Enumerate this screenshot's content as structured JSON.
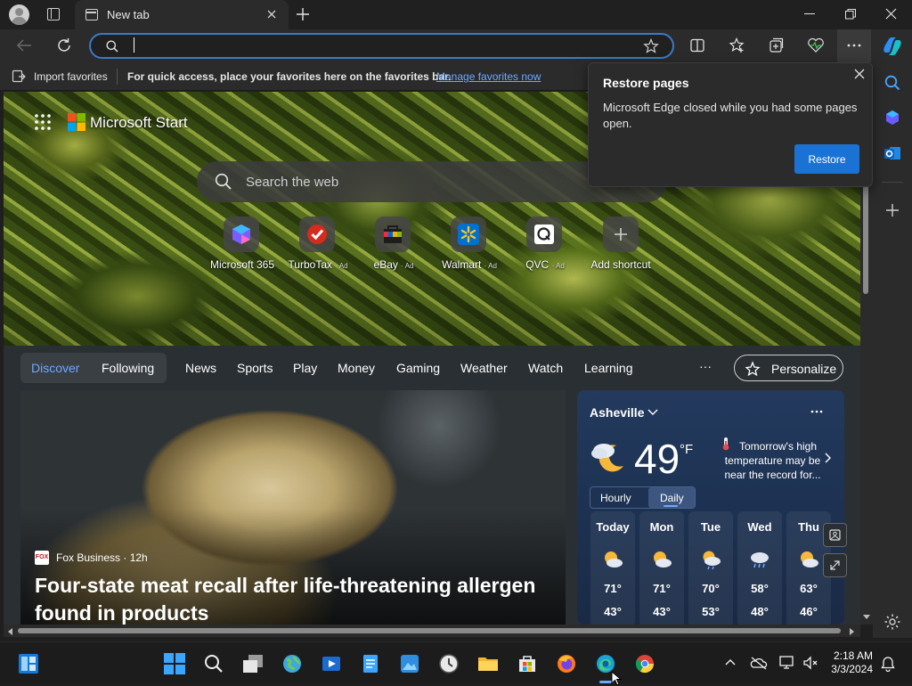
{
  "tab": {
    "title": "New tab"
  },
  "address": {
    "value": "",
    "placeholder": ""
  },
  "favbar": {
    "import_label": "Import favorites",
    "hint": "For quick access, place your favorites here on the favorites bar.",
    "manage_link": "Manage favorites now"
  },
  "brand": {
    "name": "Microsoft Start"
  },
  "search": {
    "placeholder": "Search the web"
  },
  "shortcuts": [
    {
      "label": "Microsoft 365",
      "ad": ""
    },
    {
      "label": "TurboTax",
      "ad": "· Ad"
    },
    {
      "label": "eBay",
      "ad": "· Ad"
    },
    {
      "label": "Walmart",
      "ad": "· Ad"
    },
    {
      "label": "QVC",
      "ad": "· Ad"
    },
    {
      "label": "Add shortcut",
      "ad": ""
    }
  ],
  "feednav": {
    "discover": "Discover",
    "following": "Following",
    "items": [
      "News",
      "Sports",
      "Play",
      "Money",
      "Gaming",
      "Weather",
      "Watch",
      "Learning"
    ],
    "more": "···",
    "personalize": "Personalize"
  },
  "article": {
    "source": "Fox Business · 12h",
    "source_badge": "FOX",
    "headline": "Four-state meat recall after life-threatening allergen found in products"
  },
  "weather": {
    "location": "Asheville",
    "temp": "49",
    "unit": "°F",
    "note": "Tomorrow's high temperature may be near the record for...",
    "tabs": [
      "Hourly",
      "Daily"
    ],
    "active_tab": "Daily",
    "days": [
      {
        "name": "Today",
        "hi": "71°",
        "lo": "43°",
        "icon": "sun-cloud"
      },
      {
        "name": "Mon",
        "hi": "71°",
        "lo": "43°",
        "icon": "sun-cloud"
      },
      {
        "name": "Tue",
        "hi": "70°",
        "lo": "53°",
        "icon": "sun-cloud-rain"
      },
      {
        "name": "Wed",
        "hi": "58°",
        "lo": "48°",
        "icon": "cloud-rain"
      },
      {
        "name": "Thu",
        "hi": "63°",
        "lo": "46°",
        "icon": "sun-cloud"
      }
    ]
  },
  "popup": {
    "title": "Restore pages",
    "body": "Microsoft Edge closed while you had some pages open.",
    "button": "Restore"
  },
  "taskbar": {
    "time": "2:18 AM",
    "date": "3/3/2024"
  },
  "colors": {
    "accent": "#1a73d4",
    "address_border": "#3b7ac6",
    "chrome_bg": "#2b2b2b"
  }
}
